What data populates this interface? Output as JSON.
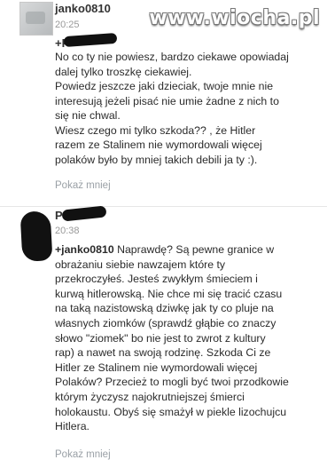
{
  "watermark": "www.wiocha.pl",
  "comment1": {
    "author": "janko0810",
    "time": "20:25",
    "mention_prefix": "+P",
    "lines": [
      "No co ty nie powiesz, bardzo ciekawe opowiadaj",
      "dalej tylko troszkę ciekawiej.",
      "Powiedz jeszcze jaki dzieciak, twoje mnie nie",
      "interesują jeżeli pisać nie umie żadne z nich to",
      "się nie chwal.",
      "Wiesz czego mi tylko szkoda?? , że Hitler",
      "razem ze Stalinem nie wymordowali więcej",
      "polaków było by mniej takich debili ja ty :)."
    ],
    "more_label": "Pokaż mniej"
  },
  "comment2": {
    "author_prefix": "P",
    "time": "20:38",
    "mention": "+janko0810",
    "lines": [
      " Naprawdę? Są pewne granice w",
      "obrażaniu siebie nawzajem które ty",
      "przekroczyłeś. Jesteś zwykłym śmieciem i",
      "kurwą hitlerowską. Nie chce mi się tracić czasu",
      "na taką nazistowską dziwkę jak ty co pluje na",
      "własnych ziomków (sprawdź głąbie co znaczy",
      "słowo \"ziomek\" bo nie jest to zwrot z kultury",
      "rap) a nawet na swoją rodzinę. Szkoda Ci ze",
      "Hitler ze Stalinem nie wymordowali więcej",
      "Polaków? Przecież to mogli być twoi przodkowie",
      "którym życzysz najokrutniejszej śmierci",
      "holokaustu. Obyś się smażył w piekle lizochujcu",
      "Hitlera."
    ],
    "more_label": "Pokaż mniej"
  }
}
